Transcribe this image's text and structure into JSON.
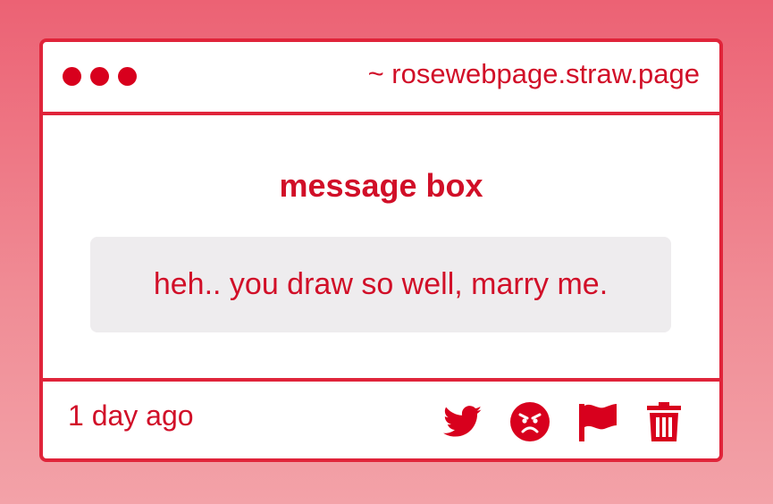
{
  "window": {
    "url": "~ rosewebpage.straw.page"
  },
  "message_box": {
    "title": "message box",
    "text": "heh.. you draw so well, marry me."
  },
  "footer": {
    "timestamp": "1 day ago",
    "actions": [
      {
        "icon": "twitter-icon"
      },
      {
        "icon": "angry-face-icon"
      },
      {
        "icon": "flag-icon"
      },
      {
        "icon": "trash-icon"
      }
    ]
  },
  "colors": {
    "accent": "#d8001d",
    "border": "#e0243a",
    "message_bg": "#eeecee",
    "background_top": "#ec6274",
    "background_bottom": "#f3a2a8"
  }
}
